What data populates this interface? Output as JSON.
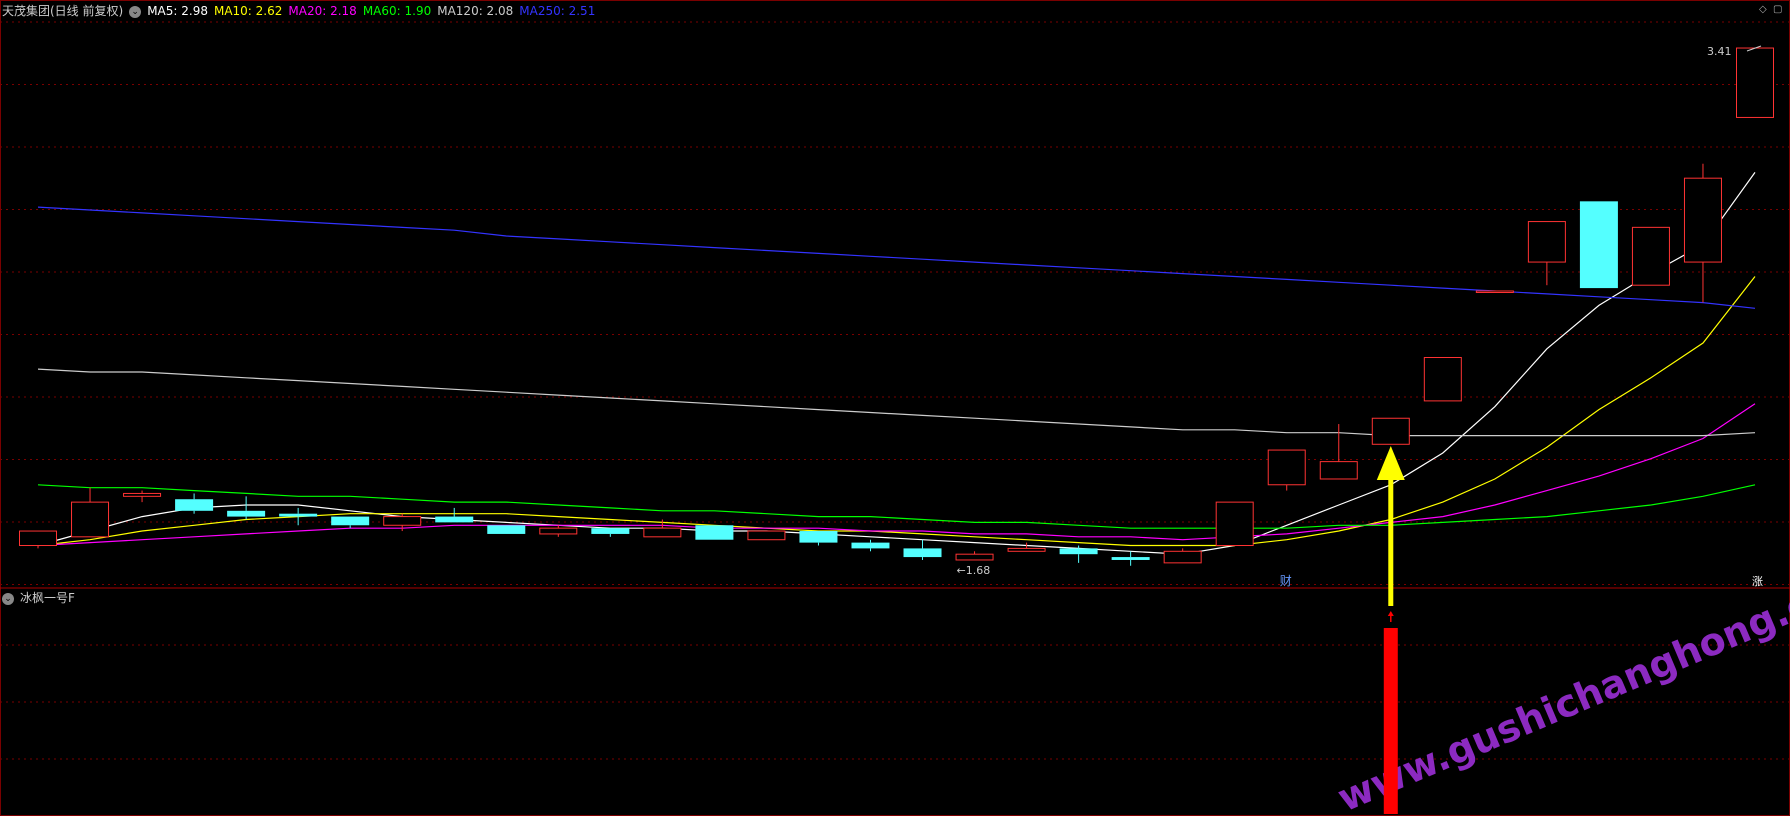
{
  "main_panel": {
    "title": "天茂集团(日线 前复权)",
    "ma_legend": [
      {
        "label": "MA5: 2.98",
        "color": "#ffffff"
      },
      {
        "label": "MA10: 2.62",
        "color": "#ffff00"
      },
      {
        "label": "MA20: 2.18",
        "color": "#ff00ff"
      },
      {
        "label": "MA60: 1.90",
        "color": "#00ff00"
      },
      {
        "label": "MA120: 2.08",
        "color": "#cccccc"
      },
      {
        "label": "MA250: 2.51",
        "color": "#3333ff"
      }
    ],
    "annotations": {
      "high_label": "3.41",
      "low_label": "←1.68",
      "fin_label": "财",
      "right_badge": "涨"
    }
  },
  "sub_panel": {
    "title": "冰枫一号F"
  },
  "watermark": "www.gushichanghong.com",
  "colors": {
    "up": "#ff3333",
    "down": "#54ffff",
    "grid": "#7a0000",
    "arrow": "#ffff00",
    "signal_bar": "#ff0000"
  },
  "chart_data": {
    "type": "candlestick",
    "title": "天茂集团(日线 前复权)",
    "ylim": [
      1.55,
      3.5
    ],
    "candles": [
      {
        "o": 1.69,
        "h": 1.74,
        "l": 1.68,
        "c": 1.74
      },
      {
        "o": 1.72,
        "h": 1.89,
        "l": 1.72,
        "c": 1.84
      },
      {
        "o": 1.86,
        "h": 1.88,
        "l": 1.84,
        "c": 1.87
      },
      {
        "o": 1.85,
        "h": 1.87,
        "l": 1.8,
        "c": 1.81
      },
      {
        "o": 1.81,
        "h": 1.86,
        "l": 1.78,
        "c": 1.79
      },
      {
        "o": 1.8,
        "h": 1.82,
        "l": 1.76,
        "c": 1.79
      },
      {
        "o": 1.79,
        "h": 1.79,
        "l": 1.75,
        "c": 1.76
      },
      {
        "o": 1.76,
        "h": 1.8,
        "l": 1.74,
        "c": 1.79
      },
      {
        "o": 1.79,
        "h": 1.82,
        "l": 1.77,
        "c": 1.77
      },
      {
        "o": 1.76,
        "h": 1.76,
        "l": 1.73,
        "c": 1.73
      },
      {
        "o": 1.73,
        "h": 1.76,
        "l": 1.72,
        "c": 1.75
      },
      {
        "o": 1.75,
        "h": 1.75,
        "l": 1.72,
        "c": 1.73
      },
      {
        "o": 1.72,
        "h": 1.78,
        "l": 1.72,
        "c": 1.75
      },
      {
        "o": 1.76,
        "h": 1.76,
        "l": 1.71,
        "c": 1.71
      },
      {
        "o": 1.71,
        "h": 1.74,
        "l": 1.71,
        "c": 1.74
      },
      {
        "o": 1.74,
        "h": 1.74,
        "l": 1.69,
        "c": 1.7
      },
      {
        "o": 1.7,
        "h": 1.71,
        "l": 1.67,
        "c": 1.68
      },
      {
        "o": 1.68,
        "h": 1.71,
        "l": 1.64,
        "c": 1.65
      },
      {
        "o": 1.64,
        "h": 1.67,
        "l": 1.64,
        "c": 1.66
      },
      {
        "o": 1.67,
        "h": 1.7,
        "l": 1.67,
        "c": 1.68
      },
      {
        "o": 1.68,
        "h": 1.69,
        "l": 1.63,
        "c": 1.66
      },
      {
        "o": 1.65,
        "h": 1.67,
        "l": 1.62,
        "c": 1.64
      },
      {
        "o": 1.63,
        "h": 1.68,
        "l": 1.63,
        "c": 1.67
      },
      {
        "o": 1.69,
        "h": 1.84,
        "l": 1.69,
        "c": 1.84
      },
      {
        "o": 1.9,
        "h": 2.02,
        "l": 1.88,
        "c": 2.02
      },
      {
        "o": 1.92,
        "h": 2.11,
        "l": 1.92,
        "c": 1.98
      },
      {
        "o": 2.04,
        "h": 2.13,
        "l": 2.04,
        "c": 2.13
      },
      {
        "o": 2.19,
        "h": 2.34,
        "l": 2.19,
        "c": 2.34
      },
      {
        "o": 2.57,
        "h": 2.57,
        "l": 2.57,
        "c": 2.57
      },
      {
        "o": 2.67,
        "h": 2.81,
        "l": 2.59,
        "c": 2.81
      },
      {
        "o": 2.88,
        "h": 2.88,
        "l": 2.58,
        "c": 2.58
      },
      {
        "o": 2.59,
        "h": 2.79,
        "l": 2.59,
        "c": 2.79
      },
      {
        "o": 2.67,
        "h": 3.01,
        "l": 2.53,
        "c": 2.96
      },
      {
        "o": 3.17,
        "h": 3.41,
        "l": 3.17,
        "c": 3.41
      }
    ],
    "ma_series": [
      {
        "name": "MA5",
        "color": "#ffffff",
        "values": [
          1.69,
          1.74,
          1.79,
          1.82,
          1.83,
          1.83,
          1.81,
          1.79,
          1.78,
          1.77,
          1.76,
          1.75,
          1.75,
          1.74,
          1.74,
          1.73,
          1.72,
          1.71,
          1.7,
          1.69,
          1.68,
          1.67,
          1.66,
          1.69,
          1.76,
          1.83,
          1.9,
          2.01,
          2.17,
          2.37,
          2.52,
          2.63,
          2.73,
          2.98
        ]
      },
      {
        "name": "MA10",
        "color": "#ffff00",
        "values": [
          1.69,
          1.71,
          1.74,
          1.76,
          1.78,
          1.79,
          1.8,
          1.8,
          1.8,
          1.8,
          1.79,
          1.78,
          1.77,
          1.76,
          1.75,
          1.74,
          1.74,
          1.73,
          1.72,
          1.71,
          1.7,
          1.69,
          1.69,
          1.69,
          1.71,
          1.74,
          1.78,
          1.84,
          1.92,
          2.03,
          2.16,
          2.27,
          2.39,
          2.62
        ]
      },
      {
        "name": "MA20",
        "color": "#ff00ff",
        "values": [
          1.69,
          1.7,
          1.71,
          1.72,
          1.73,
          1.74,
          1.75,
          1.75,
          1.76,
          1.76,
          1.76,
          1.76,
          1.76,
          1.75,
          1.75,
          1.75,
          1.74,
          1.74,
          1.73,
          1.73,
          1.72,
          1.72,
          1.71,
          1.72,
          1.73,
          1.75,
          1.77,
          1.79,
          1.83,
          1.88,
          1.93,
          1.99,
          2.06,
          2.18
        ]
      },
      {
        "name": "MA60",
        "color": "#00ff00",
        "values": [
          1.9,
          1.89,
          1.89,
          1.88,
          1.87,
          1.86,
          1.86,
          1.85,
          1.84,
          1.84,
          1.83,
          1.82,
          1.81,
          1.81,
          1.8,
          1.79,
          1.79,
          1.78,
          1.77,
          1.77,
          1.76,
          1.75,
          1.75,
          1.75,
          1.75,
          1.76,
          1.76,
          1.77,
          1.78,
          1.79,
          1.81,
          1.83,
          1.86,
          1.9
        ]
      },
      {
        "name": "MA120",
        "color": "#cccccc",
        "values": [
          2.3,
          2.29,
          2.29,
          2.28,
          2.27,
          2.26,
          2.25,
          2.24,
          2.23,
          2.22,
          2.21,
          2.2,
          2.19,
          2.18,
          2.17,
          2.16,
          2.15,
          2.14,
          2.13,
          2.12,
          2.11,
          2.1,
          2.09,
          2.09,
          2.08,
          2.08,
          2.07,
          2.07,
          2.07,
          2.07,
          2.07,
          2.07,
          2.07,
          2.08
        ]
      },
      {
        "name": "MA250",
        "color": "#3333ff",
        "values": [
          2.86,
          2.85,
          2.84,
          2.83,
          2.82,
          2.81,
          2.8,
          2.79,
          2.78,
          2.76,
          2.75,
          2.74,
          2.73,
          2.72,
          2.71,
          2.7,
          2.69,
          2.68,
          2.67,
          2.66,
          2.65,
          2.64,
          2.63,
          2.62,
          2.61,
          2.6,
          2.59,
          2.58,
          2.57,
          2.56,
          2.55,
          2.54,
          2.53,
          2.51
        ]
      }
    ],
    "signal_index": 26
  }
}
